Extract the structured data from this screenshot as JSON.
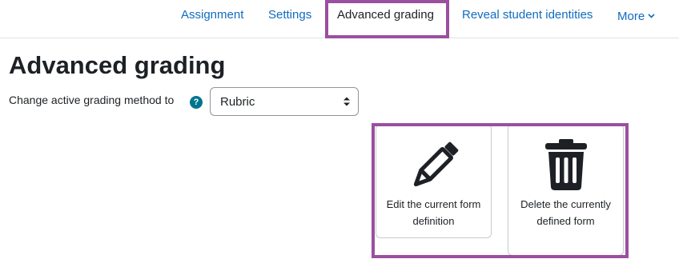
{
  "nav": {
    "tabs": [
      {
        "label": "Assignment"
      },
      {
        "label": "Settings"
      },
      {
        "label": "Advanced grading"
      },
      {
        "label": "Reveal student identities"
      },
      {
        "label": "More"
      }
    ]
  },
  "page": {
    "title": "Advanced grading"
  },
  "method": {
    "label": "Change active grading method to",
    "help_symbol": "?",
    "selected": "Rubric"
  },
  "actions": {
    "edit": {
      "label": "Edit the current form definition",
      "icon": "pencil-icon"
    },
    "delete": {
      "label": "Delete the currently defined form",
      "icon": "trash-icon"
    }
  },
  "colors": {
    "link": "#0f6cbf",
    "highlight": "#9b4f9f",
    "help": "#00758f"
  }
}
